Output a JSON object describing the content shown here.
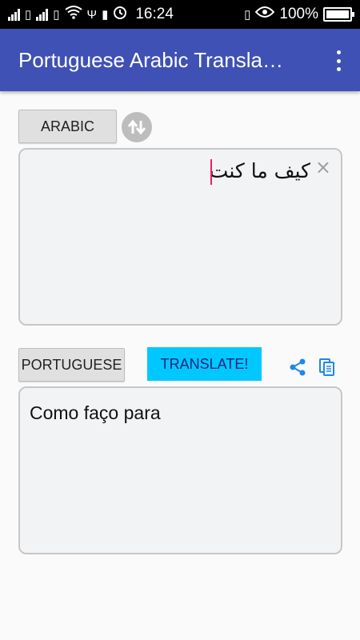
{
  "status_bar": {
    "time": "16:24",
    "battery": "100%",
    "icons": [
      "signal-icon",
      "sim-icon",
      "signal-icon",
      "sim-icon",
      "wifi-icon",
      "usb-icon",
      "battery-small-icon",
      "alarm-icon",
      "vibrate-icon",
      "eye-icon",
      "battery-icon"
    ]
  },
  "app_bar": {
    "title": "Portuguese Arabic Transla…",
    "color": "#3f51b5"
  },
  "source": {
    "language_label": "ARABIC",
    "input_text": "كيف ما كنت",
    "clear_glyph": "×"
  },
  "target": {
    "language_label": "PORTUGUESE",
    "output_text": "Como faço para"
  },
  "actions": {
    "translate_label": "TRANSLATE!",
    "translate_color": "#00c8ff",
    "accent_icon_color": "#1e88e5"
  }
}
